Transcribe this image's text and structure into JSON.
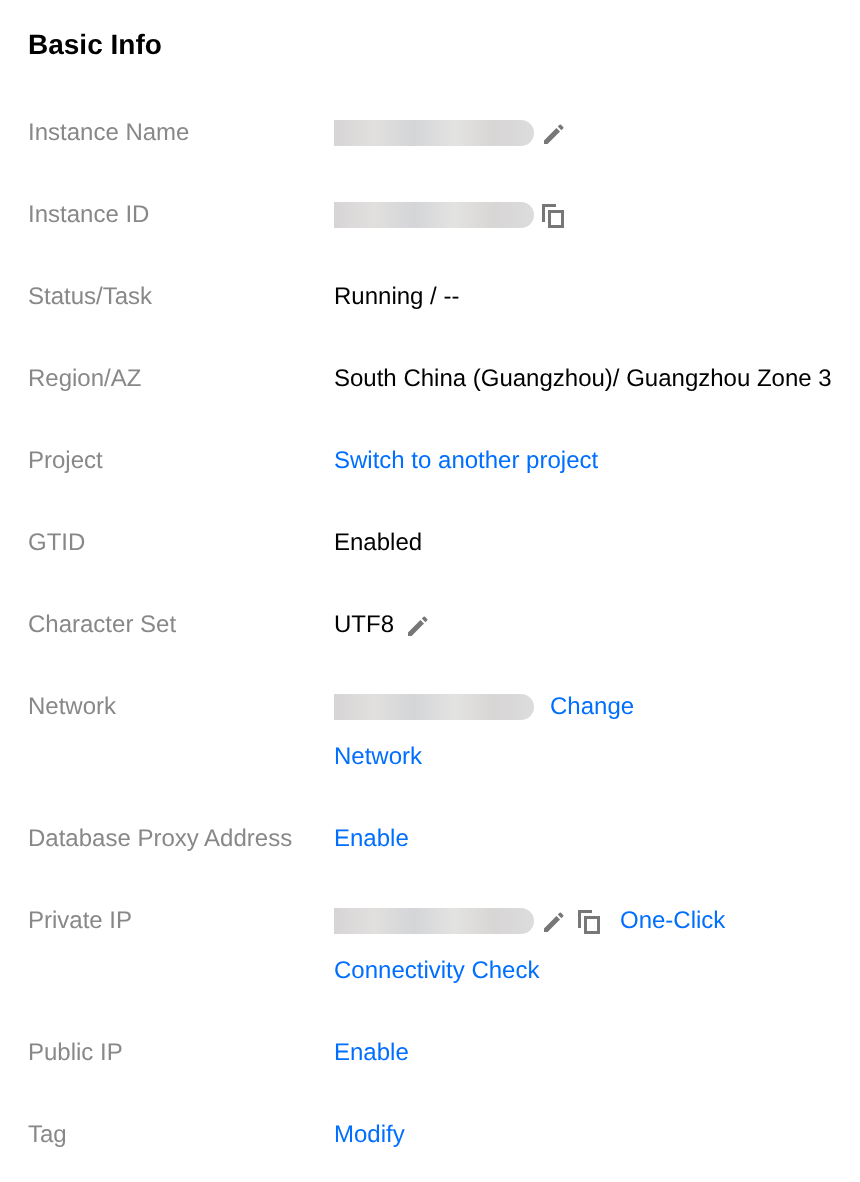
{
  "section": {
    "title": "Basic Info"
  },
  "rows": [
    {
      "label": "Instance Name",
      "lines": [
        [
          {
            "kind": "redacted"
          },
          {
            "kind": "edit"
          }
        ]
      ]
    },
    {
      "label": "Instance ID",
      "lines": [
        [
          {
            "kind": "redacted"
          },
          {
            "kind": "copy"
          }
        ]
      ]
    },
    {
      "label": "Status/Task",
      "lines": [
        [
          {
            "kind": "text",
            "text": "Running / --"
          }
        ]
      ]
    },
    {
      "label": "Region/AZ",
      "lines": [
        [
          {
            "kind": "text",
            "text": "South China (Guangzhou)/ Guangzhou Zone 3"
          }
        ]
      ]
    },
    {
      "label": "Project",
      "lines": [
        [
          {
            "kind": "link",
            "text": "Switch to another project"
          }
        ]
      ]
    },
    {
      "label": "GTID",
      "lines": [
        [
          {
            "kind": "text",
            "text": "Enabled"
          }
        ]
      ]
    },
    {
      "label": "Character Set",
      "lines": [
        [
          {
            "kind": "text",
            "text": "UTF8"
          },
          {
            "kind": "edit"
          }
        ]
      ]
    },
    {
      "label": "Network",
      "lines": [
        [
          {
            "kind": "redacted"
          },
          {
            "kind": "link",
            "text": "Change"
          }
        ],
        [
          {
            "kind": "link",
            "text": "Network"
          }
        ]
      ]
    },
    {
      "label": "Database Proxy Address",
      "lines": [
        [
          {
            "kind": "link",
            "text": "Enable"
          }
        ]
      ]
    },
    {
      "label": "Private IP",
      "lines": [
        [
          {
            "kind": "redacted"
          },
          {
            "kind": "edit"
          },
          {
            "kind": "copy"
          },
          {
            "kind": "link",
            "text": "One-Click"
          }
        ],
        [
          {
            "kind": "link",
            "text": "Connectivity Check"
          }
        ]
      ]
    },
    {
      "label": "Public IP",
      "lines": [
        [
          {
            "kind": "link",
            "text": "Enable"
          }
        ]
      ]
    },
    {
      "label": "Tag",
      "lines": [
        [
          {
            "kind": "link",
            "text": "Modify"
          }
        ]
      ]
    }
  ]
}
